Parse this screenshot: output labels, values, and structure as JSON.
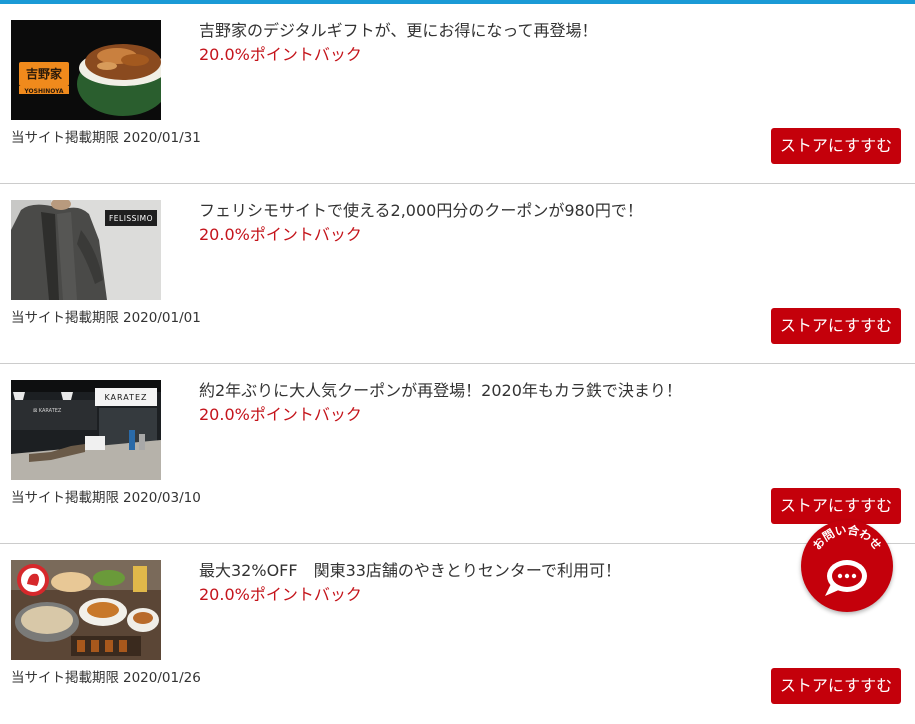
{
  "header": {
    "accent_color": "#1a9ad6"
  },
  "labels": {
    "deadline_prefix": "当サイト掲載期限"
  },
  "offers": [
    {
      "title": "吉野家のデジタルギフトが、更にお得になって再登場！",
      "points": "20.0%ポイントバック",
      "deadline": "2020/01/31",
      "button": "ストアにすすむ",
      "logo_text": "吉野家",
      "logo_sub": "YOSHINOYA"
    },
    {
      "title": "フェリシモサイトで使える2,000円分のクーポンが980円で！",
      "points": "20.0%ポイントバック",
      "deadline": "2020/01/01",
      "button": "ストアにすすむ",
      "logo_text": "FELISSIMO"
    },
    {
      "title": "約2年ぶりに大人気クーポンが再登場！2020年もカラ鉄で決まり！",
      "points": "20.0%ポイントバック",
      "deadline": "2020/03/10",
      "button": "ストアにすすむ",
      "logo_text": "KARATEZ"
    },
    {
      "title": "最大32%OFF　関東33店舗のやきとりセンターで利用可！",
      "points": "20.0%ポイントバック",
      "deadline": "2020/01/26",
      "button": "ストアにすすむ"
    }
  ],
  "contact": {
    "label": "お問い合わせ",
    "icon": "chat-bubble-icon"
  },
  "colors": {
    "button": "#c4000b",
    "points": "#c4141b"
  }
}
